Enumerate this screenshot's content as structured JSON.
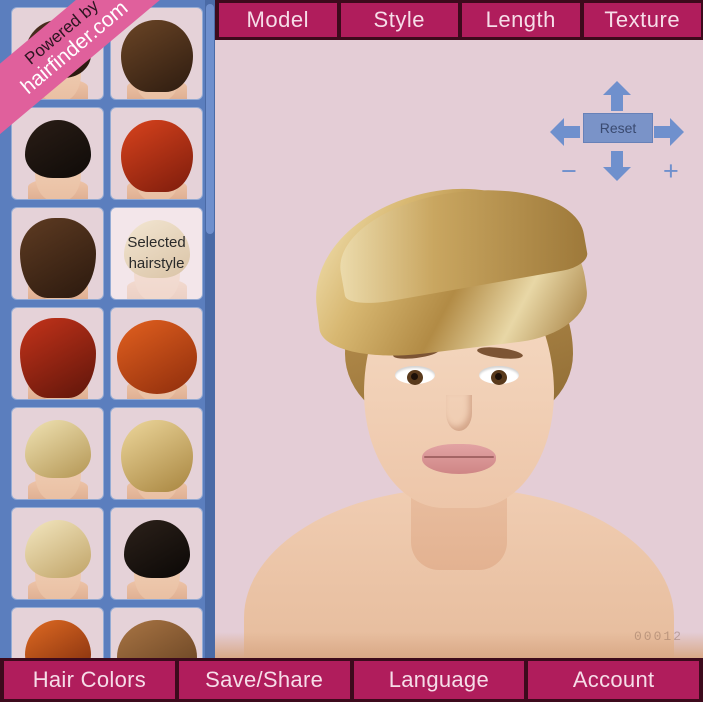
{
  "app": {
    "brand_ribbon": {
      "line1": "Powered by",
      "line2": "hairfinder.com"
    },
    "watermark": "00012",
    "colors": {
      "accent_magenta": "#B01D5C",
      "bar_dark": "#3D0A1C",
      "sidebar_blue": "#5B7EBE",
      "canvas_pink": "#E4CDD6",
      "control_blue": "#6F90CD",
      "reset_button": "#7A93C8",
      "ribbon_pink": "#E0609C",
      "tab_text": "#F6DDE8"
    }
  },
  "top_tabs": [
    {
      "label": "Model"
    },
    {
      "label": "Style"
    },
    {
      "label": "Length"
    },
    {
      "label": "Texture"
    }
  ],
  "bottom_buttons": [
    {
      "label": "Hair Colors"
    },
    {
      "label": "Save/Share"
    },
    {
      "label": "Language"
    },
    {
      "label": "Account"
    }
  ],
  "sidebar": {
    "selected_label_line1": "Selected",
    "selected_label_line2": "hairstyle",
    "thumbnails": [
      {
        "index": 1,
        "hair_color": "#3a2418",
        "shape": "short",
        "selected": false
      },
      {
        "index": 2,
        "hair_color": "#4a2a18",
        "shape": "long",
        "selected": false
      },
      {
        "index": 3,
        "hair_color": "#1c1410",
        "shape": "short",
        "selected": false
      },
      {
        "index": 4,
        "hair_color": "#a82c16",
        "shape": "long",
        "selected": false
      },
      {
        "index": 5,
        "hair_color": "#4a2d1c",
        "shape": "vlong",
        "selected": false
      },
      {
        "index": 6,
        "hair_color": "#c9a96a",
        "shape": "short",
        "selected": true
      },
      {
        "index": 7,
        "hair_color": "#9b2316",
        "shape": "vlong",
        "selected": false
      },
      {
        "index": 8,
        "hair_color": "#c24a18",
        "shape": "curly",
        "selected": false
      },
      {
        "index": 9,
        "hair_color": "#d8c089",
        "shape": "short",
        "selected": false
      },
      {
        "index": 10,
        "hair_color": "#d2b173",
        "shape": "long",
        "selected": false
      },
      {
        "index": 11,
        "hair_color": "#e0cf9e",
        "shape": "short",
        "selected": false
      },
      {
        "index": 12,
        "hair_color": "#181410",
        "shape": "short",
        "selected": false
      },
      {
        "index": 13,
        "hair_color": "#c0431a",
        "shape": "short",
        "selected": false
      },
      {
        "index": 14,
        "hair_color": "#8a5c33",
        "shape": "curly",
        "selected": false
      }
    ]
  },
  "viewer": {
    "controls": {
      "reset_label": "Reset",
      "zoom_out_label": "−",
      "zoom_in_label": "+",
      "up_icon": "arrow-up",
      "down_icon": "arrow-down",
      "left_icon": "arrow-left",
      "right_icon": "arrow-right"
    },
    "model": {
      "hairstyle": "short blonde spiky pixie",
      "hair_color": "#C9A55C"
    }
  }
}
